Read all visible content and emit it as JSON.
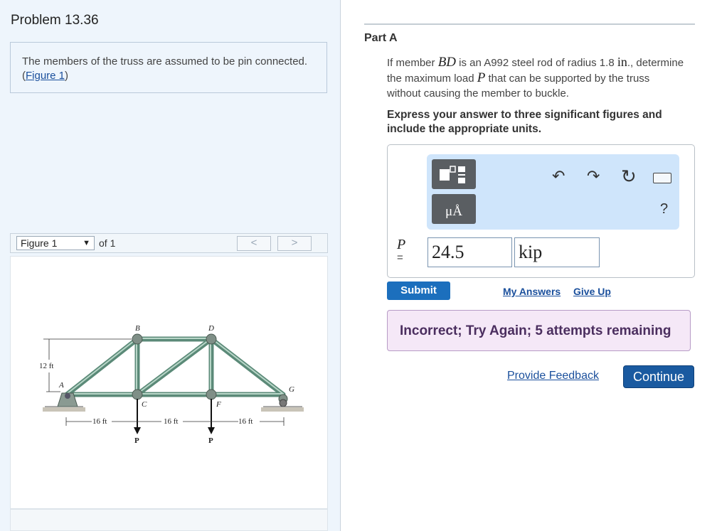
{
  "problem": {
    "title": "Problem 13.36"
  },
  "intro": {
    "text": "The members of the truss are assumed to be pin connected.",
    "figure_link_open": "(",
    "figure_link": "Figure 1",
    "figure_link_close": ")"
  },
  "figure_nav": {
    "selected": "Figure 1",
    "of_text": "of 1",
    "prev": "<",
    "next": ">"
  },
  "figure": {
    "labels": {
      "A": "A",
      "B": "B",
      "C": "C",
      "D": "D",
      "F": "F",
      "G": "G"
    },
    "dims": {
      "height": "12 ft",
      "span1": "16 ft",
      "span2": "16 ft",
      "span3": "16 ft"
    },
    "loads": {
      "p1": "P",
      "p2": "P"
    }
  },
  "part": {
    "title": "Part A",
    "question_pre": "If member ",
    "member": "BD",
    "question_mid1": " is an A992 steel rod of radius 1.8 ",
    "unit_in": "in",
    "question_mid2": "., determine the maximum load ",
    "load_var": "P",
    "question_post": " that can be supported by the truss without causing the member to buckle.",
    "instructions": "Express your answer to three significant figures and include the appropriate units."
  },
  "answer": {
    "var_label": "P",
    "equals": "=",
    "value": "24.5",
    "unit": "kip",
    "toolbar": {
      "units_button": "μÅ",
      "help": "?"
    }
  },
  "actions": {
    "submit": "Submit",
    "my_answers": "My Answers",
    "give_up": "Give Up",
    "feedback_message": "Incorrect; Try Again; 5 attempts remaining",
    "provide_feedback": "Provide Feedback",
    "continue": "Continue"
  },
  "colors": {
    "accent": "#1c6fbd",
    "toolbar_bg": "#cfe5fb",
    "incorrect_bg": "#f5e8f7",
    "incorrect_text": "#4b2e5f"
  }
}
